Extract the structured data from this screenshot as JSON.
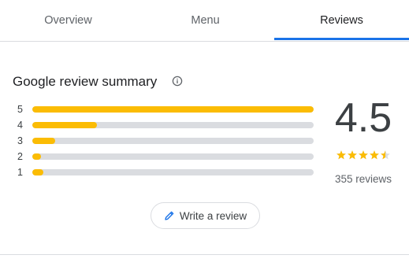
{
  "tabs": [
    {
      "label": "Overview",
      "active": false
    },
    {
      "label": "Menu",
      "active": false
    },
    {
      "label": "Reviews",
      "active": true
    }
  ],
  "summary": {
    "title": "Google review summary",
    "info_icon": "info-icon",
    "distribution": [
      {
        "stars": "5",
        "fraction": 1.0
      },
      {
        "stars": "4",
        "fraction": 0.23
      },
      {
        "stars": "3",
        "fraction": 0.08
      },
      {
        "stars": "2",
        "fraction": 0.03
      },
      {
        "stars": "1",
        "fraction": 0.04
      }
    ],
    "rating": "4.5",
    "star_rating": 4.5,
    "reviews_count": "355 reviews"
  },
  "write_review": {
    "label": "Write a review",
    "icon": "pencil-icon"
  },
  "colors": {
    "accent": "#1a73e8",
    "bar_fill": "#fbbc04",
    "bar_track": "#dadce0",
    "star": "#fbbc04"
  }
}
